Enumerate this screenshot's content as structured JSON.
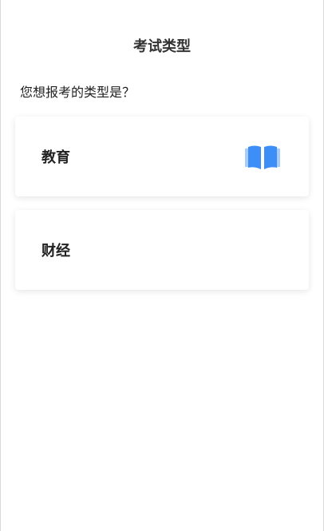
{
  "header": {
    "title": "考试类型"
  },
  "question": "您想报考的类型是？",
  "options": [
    {
      "label": "教育",
      "selected": true,
      "icon": "open-book-icon"
    },
    {
      "label": "财经",
      "selected": false
    }
  ],
  "colors": {
    "accent": "#3d8ef7",
    "accent_light": "#a9cdfb"
  }
}
